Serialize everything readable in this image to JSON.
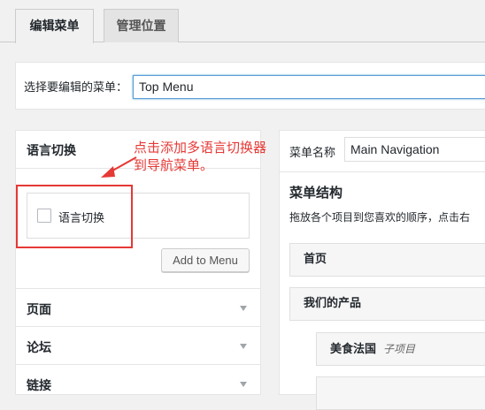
{
  "tabs": [
    {
      "label": "编辑菜单",
      "active": true
    },
    {
      "label": "管理位置",
      "active": false
    }
  ],
  "select_menu": {
    "label": "选择要编辑的菜单：",
    "value": "Top Menu"
  },
  "left_panel": {
    "lang_section_title": "语言切换",
    "checkbox_label": "语言切换",
    "add_button": "Add to Menu",
    "sections": [
      "页面",
      "论坛",
      "链接"
    ]
  },
  "annotation": {
    "line1": "点击添加多语言切换器",
    "line2": "到导航菜单。",
    "color": "#e53935"
  },
  "right_panel": {
    "name_label": "菜单名称",
    "name_value": "Main Navigation",
    "structure_title": "菜单结构",
    "structure_desc": "拖放各个项目到您喜欢的顺序，点击右",
    "items": [
      {
        "label": "首页"
      },
      {
        "label": "我们的产品"
      },
      {
        "label": "美食法国",
        "sub": "子项目"
      }
    ]
  },
  "colors": {
    "focus_border": "#5b9dd9",
    "panel_bg": "#ffffff",
    "page_bg": "#f1f1f1"
  }
}
